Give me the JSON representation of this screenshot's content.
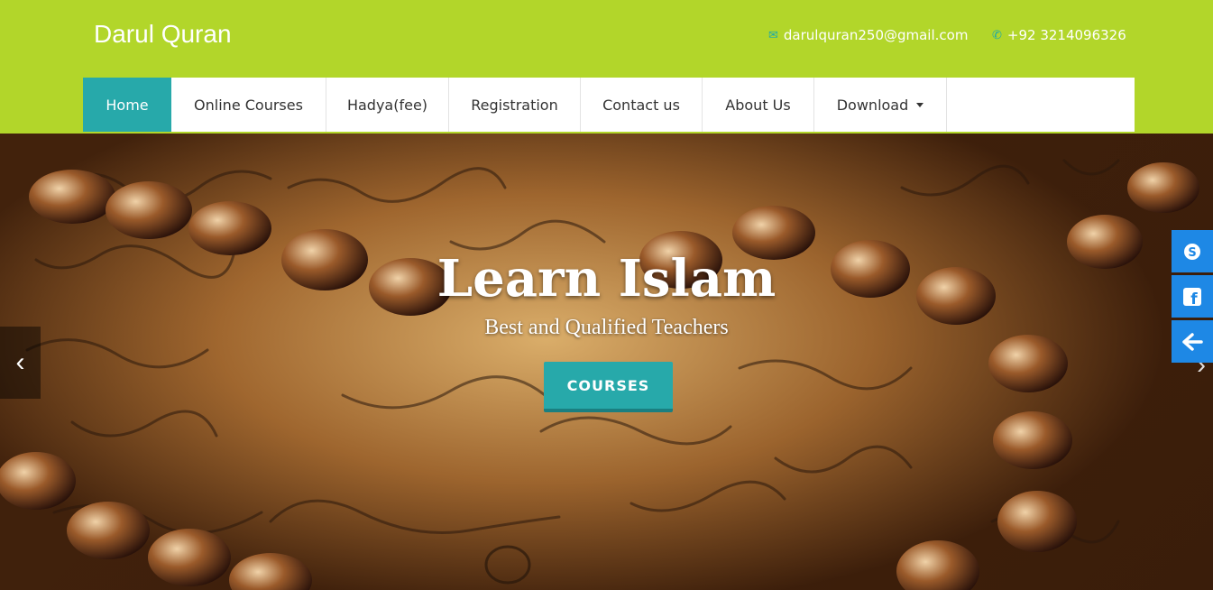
{
  "header": {
    "brand": "Darul Quran",
    "email": "darulquran250@gmail.com",
    "phone": "+92 3214096326",
    "email_icon": "envelope-icon",
    "phone_icon": "phone-icon"
  },
  "nav": {
    "items": [
      {
        "label": "Home",
        "active": true
      },
      {
        "label": "Online Courses"
      },
      {
        "label": "Hadya(fee)"
      },
      {
        "label": "Registration"
      },
      {
        "label": "Contact us"
      },
      {
        "label": "About Us"
      },
      {
        "label": "Download",
        "dropdown": true
      }
    ]
  },
  "hero": {
    "title": "Learn Islam",
    "subtitle": "Best and Qualified Teachers",
    "button": "COURSES"
  },
  "social": [
    "skype-icon",
    "facebook-icon",
    "arrow-left-icon"
  ],
  "colors": {
    "header_bg": "#b2d62a",
    "accent": "#27a9aa",
    "social_bg": "#1e88e5"
  }
}
